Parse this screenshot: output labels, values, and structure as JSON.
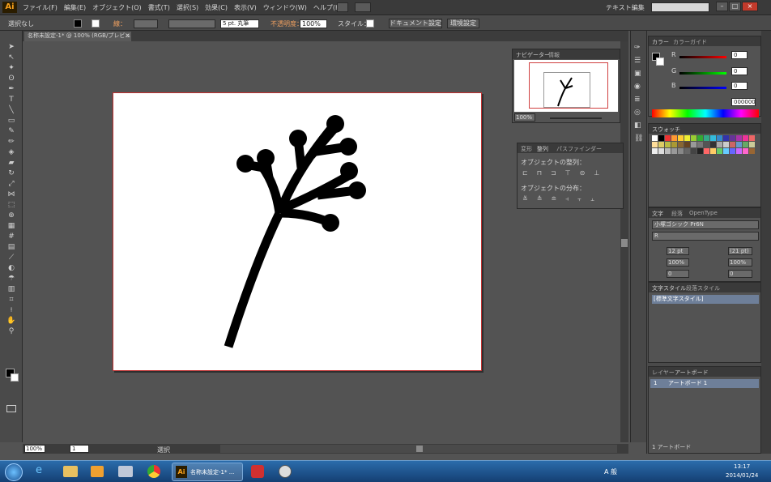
{
  "app": {
    "logo": "Ai"
  },
  "menu": [
    {
      "label": "ファイル(F)"
    },
    {
      "label": "編集(E)"
    },
    {
      "label": "オブジェクト(O)"
    },
    {
      "label": "書式(T)"
    },
    {
      "label": "選択(S)"
    },
    {
      "label": "効果(C)"
    },
    {
      "label": "表示(V)"
    },
    {
      "label": "ウィンドウ(W)"
    },
    {
      "label": "ヘルプ(H)"
    }
  ],
  "workspace": {
    "label": "テキスト編集",
    "search_placeholder": ""
  },
  "control": {
    "selection": "選択なし",
    "stroke_label": "線：",
    "brush": "5 pt. 丸筆",
    "opacity_label": "不透明度：",
    "opacity": "100%",
    "style_label": "スタイル：",
    "doc_setup": "ドキュメント設定",
    "prefs": "環境設定"
  },
  "document": {
    "tab_title": "名称未設定-1* @ 100% (RGB/プレビュー)",
    "close": "×"
  },
  "status": {
    "zoom": "100%",
    "page": "1",
    "mode": "選択"
  },
  "navigator": {
    "tab1": "ナビゲーター",
    "tab2": "情報",
    "zoom": "100%"
  },
  "align": {
    "tabs": [
      "変形",
      "整列",
      "パスファインダー"
    ],
    "objects_title": "オブジェクトの整列：",
    "distribute_title": "オブジェクトの分布："
  },
  "color": {
    "tab1": "カラー",
    "tab2": "カラーガイド",
    "r_label": "R",
    "g_label": "G",
    "b_label": "B",
    "r": "0",
    "g": "0",
    "b": "0",
    "hex": "000000"
  },
  "swatches": {
    "tab": "スウォッチ"
  },
  "character": {
    "tabs": [
      "文字",
      "段落",
      "OpenType"
    ],
    "font": "小塚ゴシック Pr6N",
    "style": "R",
    "size": "12 pt",
    "leading": "(21 pt)",
    "vscale": "100%",
    "hscale": "100%",
    "kerning": "0",
    "tracking": "0"
  },
  "char_styles": {
    "tab1": "文字スタイル",
    "tab2": "段落スタイル",
    "item": "[標準文字スタイル]"
  },
  "layers": {
    "tab1": "レイヤー",
    "tab2": "アートボード",
    "row_num": "1",
    "row_name": "アートボード 1",
    "footer": "1 アートボード"
  },
  "taskbar": {
    "app_button": "名称未設定-1* ...",
    "ime": "A 般",
    "time": "13:17",
    "date": "2014/01/24"
  },
  "colors": {
    "accent": "#e03030",
    "taskbar": "#1a5a9a"
  }
}
